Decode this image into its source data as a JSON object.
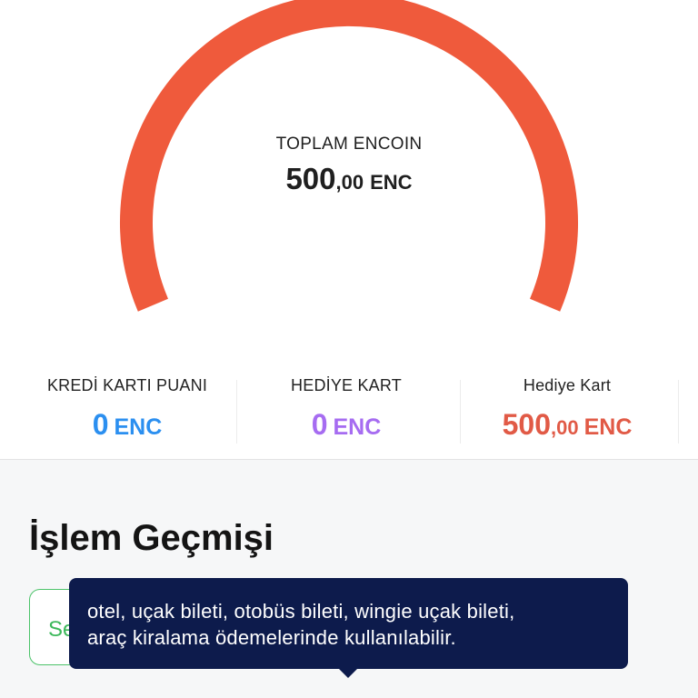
{
  "colors": {
    "gauge": "#ef5a3c",
    "blue": "#2b8ff0",
    "purple": "#a66cf1",
    "red": "#e15a46",
    "tooltip_bg": "#0d1b4c",
    "chip_green": "#3cb85a"
  },
  "summary": {
    "label": "TOPLAM ENCOIN",
    "value_int": "500",
    "value_dec": ",00",
    "unit": "ENC"
  },
  "balances": [
    {
      "label": "KREDİ KARTI PUANI",
      "value_int": "0",
      "value_dec": "",
      "unit": "ENC"
    },
    {
      "label": "HEDİYE KART",
      "value_int": "0",
      "value_dec": "",
      "unit": "ENC"
    },
    {
      "label": "Hediye Kart",
      "value_int": "500",
      "value_dec": ",00",
      "unit": "ENC"
    }
  ],
  "history": {
    "title": "İşlem Geçmişi",
    "filter_chip_text": "Se"
  },
  "tooltip": {
    "line1": "otel, uçak bileti, otobüs bileti, wingie uçak bileti,",
    "line2": "araç kiralama  ödemelerinde kullanılabilir."
  }
}
